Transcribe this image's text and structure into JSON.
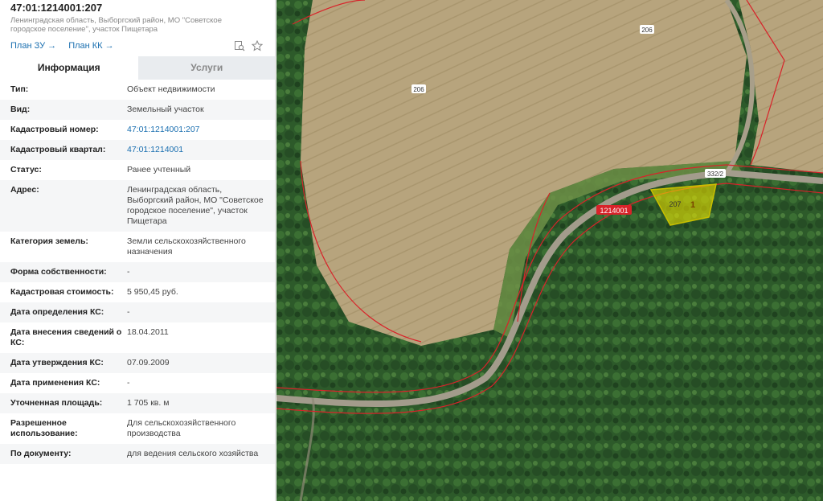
{
  "header": {
    "title": "47:01:1214001:207",
    "address": "Ленинградская область, Выборгский район, МО \"Советское городское поселение\", участок Пищетара"
  },
  "links": {
    "plan_zu": "План ЗУ →",
    "plan_kk": "План КК →"
  },
  "tools": {
    "search_icon": "search-document-icon",
    "star_icon": "star-icon"
  },
  "tabs": {
    "info": "Информация",
    "services": "Услуги"
  },
  "rows": [
    {
      "key": "Тип:",
      "value": "Объект недвижимости"
    },
    {
      "key": "Вид:",
      "value": "Земельный участок"
    },
    {
      "key": "Кадастровый номер:",
      "value": "47:01:1214001:207",
      "link": true
    },
    {
      "key": "Кадастровый квартал:",
      "value": "47:01:1214001",
      "link": true
    },
    {
      "key": "Статус:",
      "value": "Ранее учтенный"
    },
    {
      "key": "Адрес:",
      "value": "Ленинградская область, Выборгский район, МО \"Советское городское поселение\", участок Пищетара"
    },
    {
      "key": "Категория земель:",
      "value": "Земли сельскохозяйственного назначения"
    },
    {
      "key": "Форма собственности:",
      "value": "-"
    },
    {
      "key": "Кадастровая стоимость:",
      "value": "5 950,45 руб."
    },
    {
      "key": "Дата определения КС:",
      "value": "-"
    },
    {
      "key": "Дата внесения сведений о КС:",
      "value": "18.04.2011"
    },
    {
      "key": "Дата утверждения КС:",
      "value": "07.09.2009"
    },
    {
      "key": "Дата применения КС:",
      "value": "-"
    },
    {
      "key": "Уточненная площадь:",
      "value": "1 705 кв. м"
    },
    {
      "key": "Разрешенное использование:",
      "value": "Для сельскохозяйственного производства"
    },
    {
      "key": "По документу:",
      "value": "для ведения сельского хозяйства"
    }
  ],
  "map": {
    "labels": {
      "parcel_206_a": "206",
      "parcel_206_b": "206",
      "parcel_332_2": "332/2",
      "parcel_207": "207",
      "parcel_1": "1",
      "quarter": "1214001"
    },
    "colors": {
      "boundary": "#d8232a",
      "selected_fill": "#e8e000",
      "field": "#b9a57c",
      "forest": "#2f5a2c"
    }
  }
}
